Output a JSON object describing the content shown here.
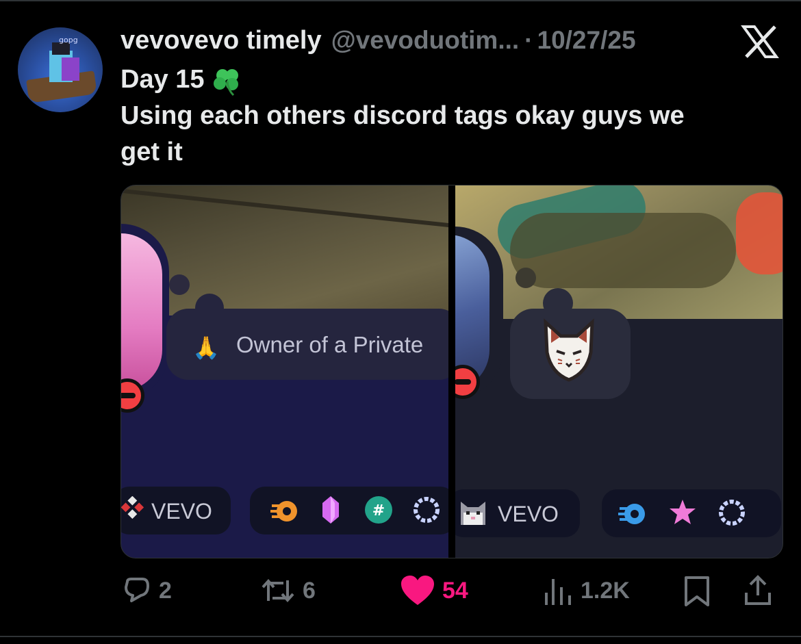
{
  "tweet": {
    "display_name": "vevovevo timely",
    "handle": "@vevoduotim...",
    "separator": "·",
    "date": "10/27/25",
    "avatar_label": "gopg",
    "text_line1": "Day 15",
    "text_line2": "Using each others discord tags okay guys we",
    "text_line3": "get it"
  },
  "media": {
    "left": {
      "status_text": "Owner of a Private",
      "tag_label": "VEVO"
    },
    "right": {
      "tag_label": "VEVO"
    }
  },
  "actions": {
    "replies": "2",
    "reposts": "6",
    "likes": "54",
    "views": "1.2K"
  },
  "colors": {
    "background": "#000000",
    "muted": "#71767b",
    "like": "#f91880",
    "text": "#e7e9ea"
  },
  "icons": [
    "x-logo-icon",
    "clover-icon",
    "reply-icon",
    "repost-icon",
    "heart-icon",
    "views-icon",
    "bookmark-icon",
    "share-icon",
    "pray-emoji-icon",
    "fox-mask-icon",
    "dnd-status-icon"
  ]
}
